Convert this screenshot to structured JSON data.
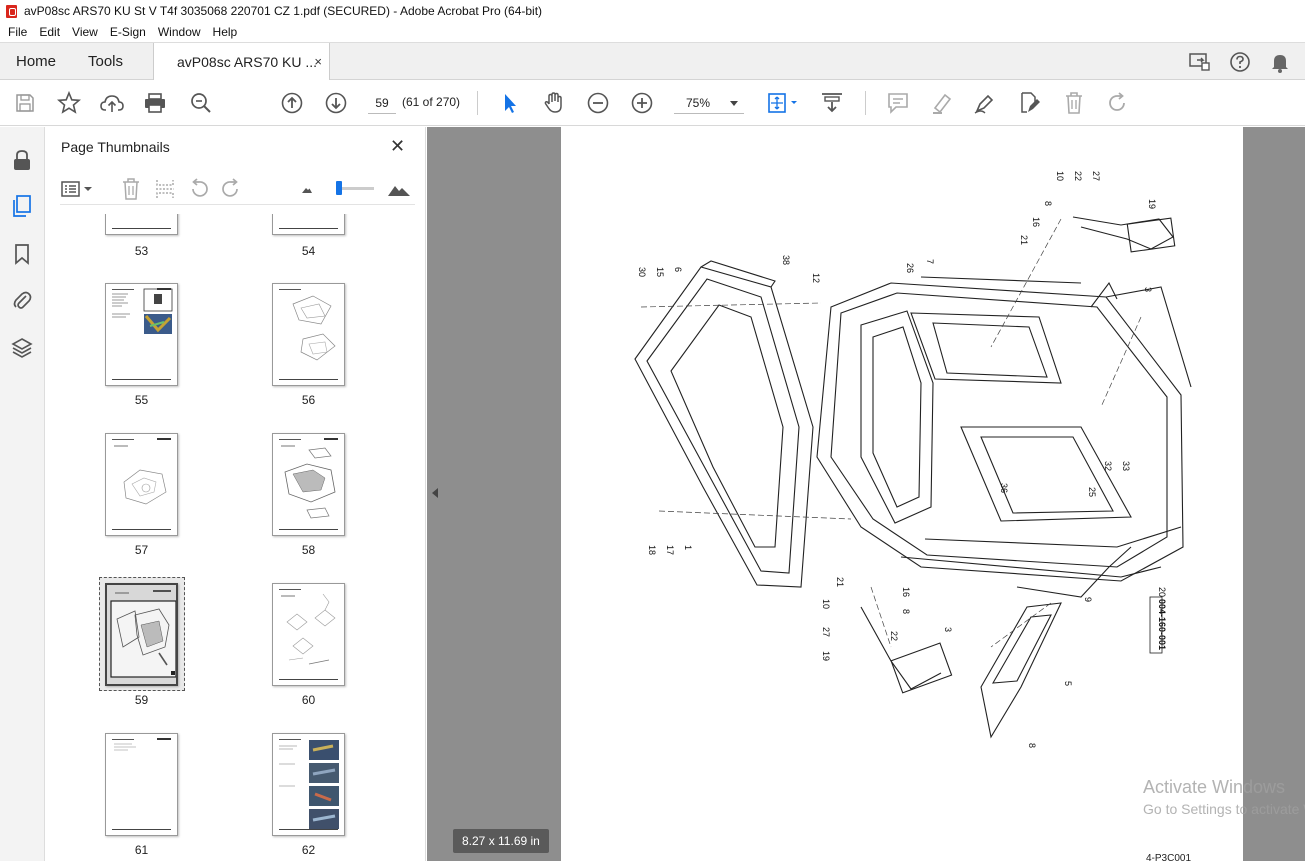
{
  "window": {
    "title": "avP08sc ARS70 KU St V T4f 3035068 220701 CZ 1.pdf (SECURED) - Adobe Acrobat Pro (64-bit)"
  },
  "menu": [
    "File",
    "Edit",
    "View",
    "E-Sign",
    "Window",
    "Help"
  ],
  "tabs": {
    "home": "Home",
    "tools": "Tools",
    "document": "avP08sc ARS70 KU ...",
    "close": "×"
  },
  "toolbar": {
    "page_number": "59",
    "page_count": "(61 of 270)",
    "zoom": "75%"
  },
  "panel": {
    "title": "Page Thumbnails",
    "close": "✕",
    "thumbnails": [
      {
        "label": "53"
      },
      {
        "label": "54"
      },
      {
        "label": "55"
      },
      {
        "label": "56"
      },
      {
        "label": "57"
      },
      {
        "label": "58"
      },
      {
        "label": "59",
        "selected": true
      },
      {
        "label": "60"
      },
      {
        "label": "61"
      },
      {
        "label": "62"
      }
    ],
    "thumbnail_size_fraction": 0.08
  },
  "viewer": {
    "page_size": "8.27 x 11.69 in",
    "drawing_code": "004-160-001",
    "footer_code": "4-P3C001",
    "callouts": [
      "10",
      "22",
      "27",
      "19",
      "8",
      "16",
      "21",
      "3",
      "30",
      "15",
      "6",
      "26",
      "7",
      "12",
      "38",
      "36",
      "32",
      "33",
      "25",
      "18",
      "17",
      "1",
      "20",
      "9",
      "5",
      "8",
      "10",
      "21",
      "16",
      "8",
      "22",
      "27",
      "19",
      "3"
    ]
  },
  "os_watermark": {
    "line1": "Activate Windows",
    "line2": "Go to Settings to activate Windows."
  },
  "colors": {
    "accent": "#1473e6",
    "viewer_bg": "#8e8e8e",
    "pdf_red": "#d9261c"
  }
}
